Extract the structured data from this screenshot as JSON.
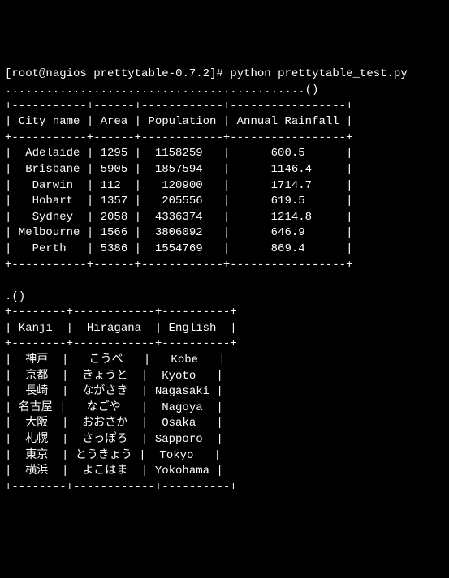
{
  "prompt": {
    "user": "root",
    "host": "nagios",
    "cwd": "prettytable-0.7.2",
    "char": "#",
    "command": "python prettytable_test.py"
  },
  "dots_line_1": "............................................()",
  "chart_data": [
    {
      "type": "table",
      "title": "",
      "columns": [
        "City name",
        "Area",
        "Population",
        "Annual Rainfall"
      ],
      "rows": [
        [
          "Adelaide",
          1295,
          1158259,
          600.5
        ],
        [
          "Brisbane",
          5905,
          1857594,
          1146.4
        ],
        [
          "Darwin",
          112,
          120900,
          1714.7
        ],
        [
          "Hobart",
          1357,
          205556,
          619.5
        ],
        [
          "Sydney",
          2058,
          4336374,
          1214.8
        ],
        [
          "Melbourne",
          1566,
          3806092,
          646.9
        ],
        [
          "Perth",
          5386,
          1554769,
          869.4
        ]
      ]
    },
    {
      "type": "table",
      "title": "",
      "columns": [
        "Kanji",
        "Hiragana",
        "English"
      ],
      "rows": [
        [
          "神戸",
          "こうべ",
          "Kobe"
        ],
        [
          "京都",
          "きょうと",
          "Kyoto"
        ],
        [
          "長崎",
          "ながさき",
          "Nagasaki"
        ],
        [
          "名古屋",
          "なごや",
          "Nagoya"
        ],
        [
          "大阪",
          "おおさか",
          "Osaka"
        ],
        [
          "札幌",
          "さっぽろ",
          "Sapporo"
        ],
        [
          "東京",
          "とうきょう",
          "Tokyo"
        ],
        [
          "横浜",
          "よこはま",
          "Yokohama"
        ]
      ]
    }
  ],
  "between_tables": ".()",
  "table1": {
    "border_top": "+-----------+------+------------+-----------------+",
    "header": "| City name | Area | Population | Annual Rainfall |",
    "border_mid": "+-----------+------+------------+-----------------+",
    "r0": "|  Adelaide | 1295 |  1158259   |      600.5      |",
    "r1": "|  Brisbane | 5905 |  1857594   |      1146.4     |",
    "r2": "|   Darwin  | 112  |   120900   |      1714.7     |",
    "r3": "|   Hobart  | 1357 |   205556   |      619.5      |",
    "r4": "|   Sydney  | 2058 |  4336374   |      1214.8     |",
    "r5": "| Melbourne | 1566 |  3806092   |      646.9      |",
    "r6": "|   Perth   | 5386 |  1554769   |      869.4      |",
    "border_bot": "+-----------+------+------------+-----------------+"
  },
  "table2": {
    "border_top": "+--------+------------+----------+",
    "header": "| Kanji  |  Hiragana  | English  |",
    "border_mid": "+--------+------------+----------+",
    "r0": "|  神戸  |   こうべ   |   Kobe   |",
    "r1": "|  京都  |  きょうと  |  Kyoto   |",
    "r2": "|  長崎  |  ながさき  | Nagasaki |",
    "r3": "| 名古屋 |   なごや   |  Nagoya  |",
    "r4": "|  大阪  |  おおさか  |  Osaka   |",
    "r5": "|  札幌  |  さっぽろ  | Sapporo  |",
    "r6": "|  東京  | とうきょう |  Tokyo   |",
    "r7": "|  横浜  |  よこはま  | Yokohama |",
    "border_bot": "+--------+------------+----------+"
  }
}
